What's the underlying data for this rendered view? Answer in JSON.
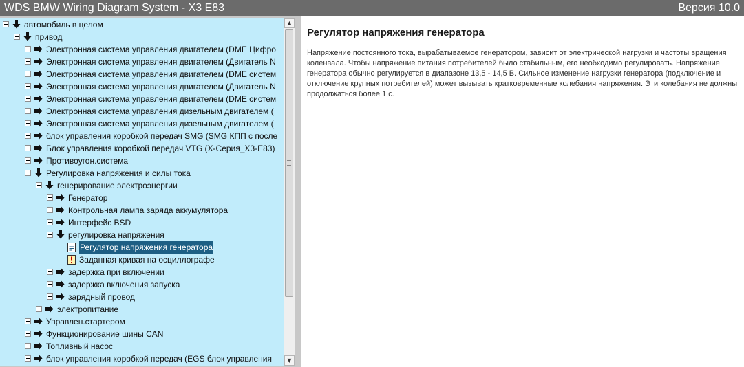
{
  "window": {
    "title": "WDS BMW Wiring Diagram System - X3 E83",
    "version": "Версия 10.0"
  },
  "tree": {
    "items": [
      {
        "label": "автомобиль в целом",
        "level": 0,
        "state": "expanded",
        "icon": "arrow-down-icon"
      },
      {
        "label": "привод",
        "level": 1,
        "state": "expanded",
        "icon": "arrow-down-icon"
      },
      {
        "label": "Электронная система управления двигателем (DME Цифро",
        "level": 2,
        "state": "collapsed",
        "icon": "arrow-right-icon"
      },
      {
        "label": "Электронная система управления двигателем (Двигатель N",
        "level": 2,
        "state": "collapsed",
        "icon": "arrow-right-icon"
      },
      {
        "label": "Электронная система управления двигателем (DME систем",
        "level": 2,
        "state": "collapsed",
        "icon": "arrow-right-icon"
      },
      {
        "label": "Электронная система управления двигателем (Двигатель N",
        "level": 2,
        "state": "collapsed",
        "icon": "arrow-right-icon"
      },
      {
        "label": "Электронная система управления двигателем (DME систем",
        "level": 2,
        "state": "collapsed",
        "icon": "arrow-right-icon"
      },
      {
        "label": "Электронная система управления дизельным двигателем (",
        "level": 2,
        "state": "collapsed",
        "icon": "arrow-right-icon"
      },
      {
        "label": "Электронная система управления дизельным двигателем (",
        "level": 2,
        "state": "collapsed",
        "icon": "arrow-right-icon"
      },
      {
        "label": "блок управления коробкой передач SMG (SMG КПП с после",
        "level": 2,
        "state": "collapsed",
        "icon": "arrow-right-icon"
      },
      {
        "label": "Блок управления коробкой передач VTG (X-Серия_X3-E83)",
        "level": 2,
        "state": "collapsed",
        "icon": "arrow-right-icon"
      },
      {
        "label": "Противоугон.система",
        "level": 2,
        "state": "collapsed",
        "icon": "arrow-right-icon"
      },
      {
        "label": "Регулировка напряжения и силы тока",
        "level": 2,
        "state": "expanded",
        "icon": "arrow-down-icon"
      },
      {
        "label": "генерирование электроэнергии",
        "level": 3,
        "state": "expanded",
        "icon": "arrow-down-icon"
      },
      {
        "label": "Генератор",
        "level": 4,
        "state": "collapsed",
        "icon": "arrow-right-icon"
      },
      {
        "label": "Контрольная лампа заряда аккумулятора",
        "level": 4,
        "state": "collapsed",
        "icon": "arrow-right-icon"
      },
      {
        "label": "Интерфейс BSD",
        "level": 4,
        "state": "collapsed",
        "icon": "arrow-right-icon"
      },
      {
        "label": "регулировка напряжения",
        "level": 4,
        "state": "expanded",
        "icon": "arrow-down-icon"
      },
      {
        "label": "Регулятор напряжения генератора",
        "level": 5,
        "state": "leaf",
        "icon": "document-icon",
        "selected": true
      },
      {
        "label": "Заданная кривая на осциллографе",
        "level": 5,
        "state": "leaf",
        "icon": "warning-icon"
      },
      {
        "label": "задержка при включении",
        "level": 4,
        "state": "collapsed",
        "icon": "arrow-right-icon"
      },
      {
        "label": "задержка включения запуска",
        "level": 4,
        "state": "collapsed",
        "icon": "arrow-right-icon"
      },
      {
        "label": "зарядный провод",
        "level": 4,
        "state": "collapsed",
        "icon": "arrow-right-icon"
      },
      {
        "label": "электропитание",
        "level": 3,
        "state": "collapsed",
        "icon": "arrow-right-icon"
      },
      {
        "label": "Управлен.стартером",
        "level": 2,
        "state": "collapsed",
        "icon": "arrow-right-icon"
      },
      {
        "label": "Функционирование шины CAN",
        "level": 2,
        "state": "collapsed",
        "icon": "arrow-right-icon"
      },
      {
        "label": "Топливный насос",
        "level": 2,
        "state": "collapsed",
        "icon": "arrow-right-icon"
      },
      {
        "label": "блок управления коробкой передач (EGS блок управления",
        "level": 2,
        "state": "collapsed",
        "icon": "arrow-right-icon"
      }
    ]
  },
  "content": {
    "title": "Регулятор напряжения генератора",
    "text": "Напряжение постоянного тока, вырабатываемое генератором, зависит от электрической нагрузки и частоты вращения коленвала. Чтобы напряжение питания потребителей было стабильным, его необходимо регулировать. Напряжение генератора обычно регулируется в диапазоне 13,5 - 14,5 В. Сильное изменение нагрузки генератора (подключение и отключение крупных потребителей) может вызывать кратковременные колебания напряжения. Эти колебания не должны продолжаться более 1 с."
  },
  "colors": {
    "titlebar": "#6b6b6b",
    "tree_background": "#c1ecfb",
    "selection": "#1d5f84"
  }
}
